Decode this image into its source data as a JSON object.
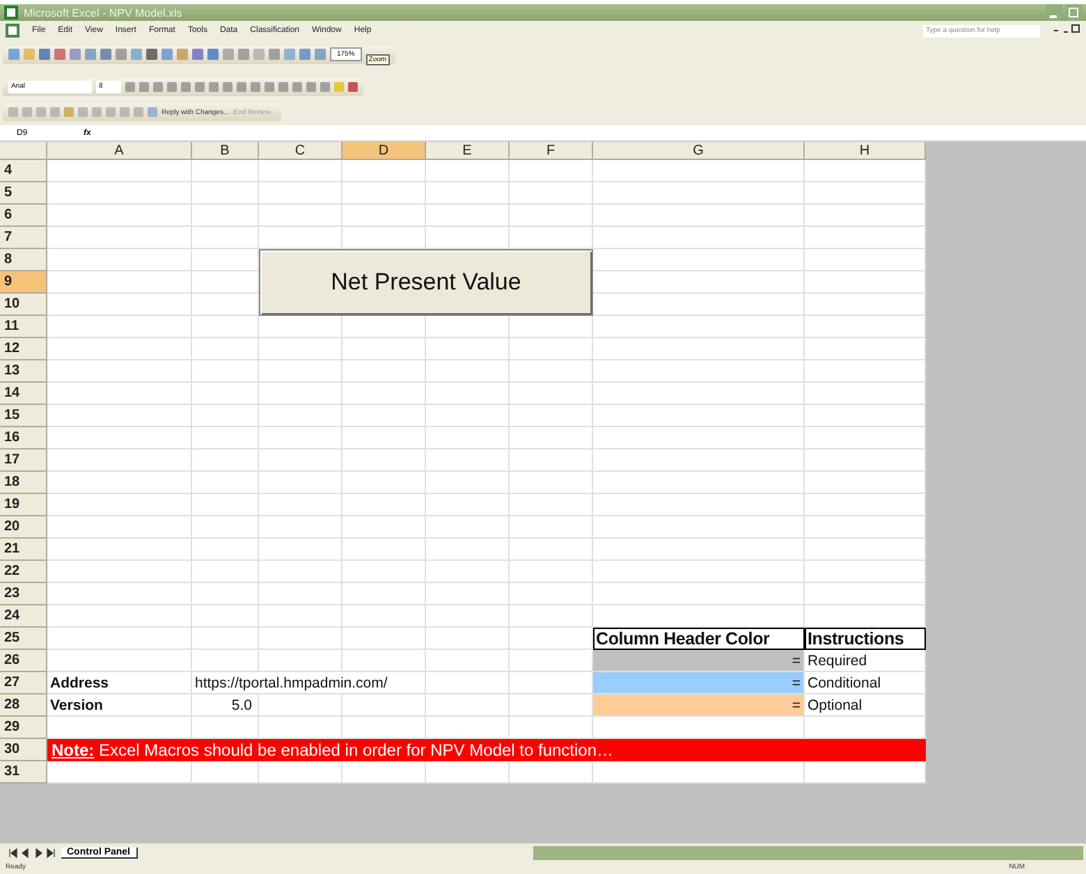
{
  "window": {
    "title": "Microsoft Excel - NPV Model.xls"
  },
  "menu": [
    "File",
    "Edit",
    "View",
    "Insert",
    "Format",
    "Tools",
    "Data",
    "Classification",
    "Window",
    "Help"
  ],
  "help_box": {
    "placeholder": "Type a question for help"
  },
  "toolbar": {
    "zoom": "175%",
    "tooltip": "Zoom"
  },
  "format_bar": {
    "font": "Arial",
    "size": "8"
  },
  "review_bar": {
    "reply": "Reply with Changes...",
    "end_review": "End Review..."
  },
  "formula_bar": {
    "name_box": "D9",
    "fx": "fx"
  },
  "sheet": {
    "columns": [
      {
        "label": "A",
        "selected": false
      },
      {
        "label": "B",
        "selected": false
      },
      {
        "label": "C",
        "selected": false
      },
      {
        "label": "D",
        "selected": true
      },
      {
        "label": "E",
        "selected": false
      },
      {
        "label": "F",
        "selected": false
      },
      {
        "label": "G",
        "selected": false
      },
      {
        "label": "H",
        "selected": false
      }
    ],
    "rows": [
      {
        "label": "4",
        "selected": false
      },
      {
        "label": "5",
        "selected": false
      },
      {
        "label": "6",
        "selected": false
      },
      {
        "label": "7",
        "selected": false
      },
      {
        "label": "8",
        "selected": false
      },
      {
        "label": "9",
        "selected": true
      },
      {
        "label": "10",
        "selected": false
      },
      {
        "label": "11",
        "selected": false
      },
      {
        "label": "12",
        "selected": false
      },
      {
        "label": "13",
        "selected": false
      },
      {
        "label": "14",
        "selected": false
      },
      {
        "label": "15",
        "selected": false
      },
      {
        "label": "16",
        "selected": false
      },
      {
        "label": "17",
        "selected": false
      },
      {
        "label": "18",
        "selected": false
      },
      {
        "label": "19",
        "selected": false
      },
      {
        "label": "20",
        "selected": false
      },
      {
        "label": "21",
        "selected": false
      },
      {
        "label": "22",
        "selected": false
      },
      {
        "label": "23",
        "selected": false
      },
      {
        "label": "24",
        "selected": false
      },
      {
        "label": "25",
        "selected": false,
        "cells": {
          "G": {
            "text": "Column Header Color",
            "kind": "heading"
          },
          "H": {
            "text": "Instructions",
            "kind": "heading"
          }
        }
      },
      {
        "label": "26",
        "selected": false,
        "cells": {
          "G": {
            "text": "=",
            "kind": "swatch",
            "color": "#c0c0c0"
          },
          "H": {
            "text": "Required",
            "kind": "plain"
          }
        }
      },
      {
        "label": "27",
        "selected": false,
        "cells": {
          "A": {
            "text": "Address",
            "kind": "label"
          },
          "B": {
            "text": "https://tportal.hmpadmin.com/",
            "kind": "plain"
          },
          "G": {
            "text": "=",
            "kind": "swatch",
            "color": "#99ccff"
          },
          "H": {
            "text": "Conditional",
            "kind": "plain"
          }
        }
      },
      {
        "label": "28",
        "selected": false,
        "cells": {
          "A": {
            "text": "Version",
            "kind": "label"
          },
          "B": {
            "text": "5.0",
            "kind": "number"
          },
          "G": {
            "text": "=",
            "kind": "swatch",
            "color": "#ffcc99"
          },
          "H": {
            "text": "Optional",
            "kind": "plain"
          }
        }
      },
      {
        "label": "29",
        "selected": false
      },
      {
        "label": "30",
        "selected": false,
        "note": "**Note:** Excel Macros should be enabled in order for NPV Model to function…"
      },
      {
        "label": "31",
        "selected": false
      }
    ]
  },
  "sheet_button": "Net Present Value",
  "sheet_tabs": [
    {
      "label": "Control Panel",
      "selected": true
    }
  ],
  "status_bar": {
    "left": "Ready",
    "right": "NUM"
  }
}
